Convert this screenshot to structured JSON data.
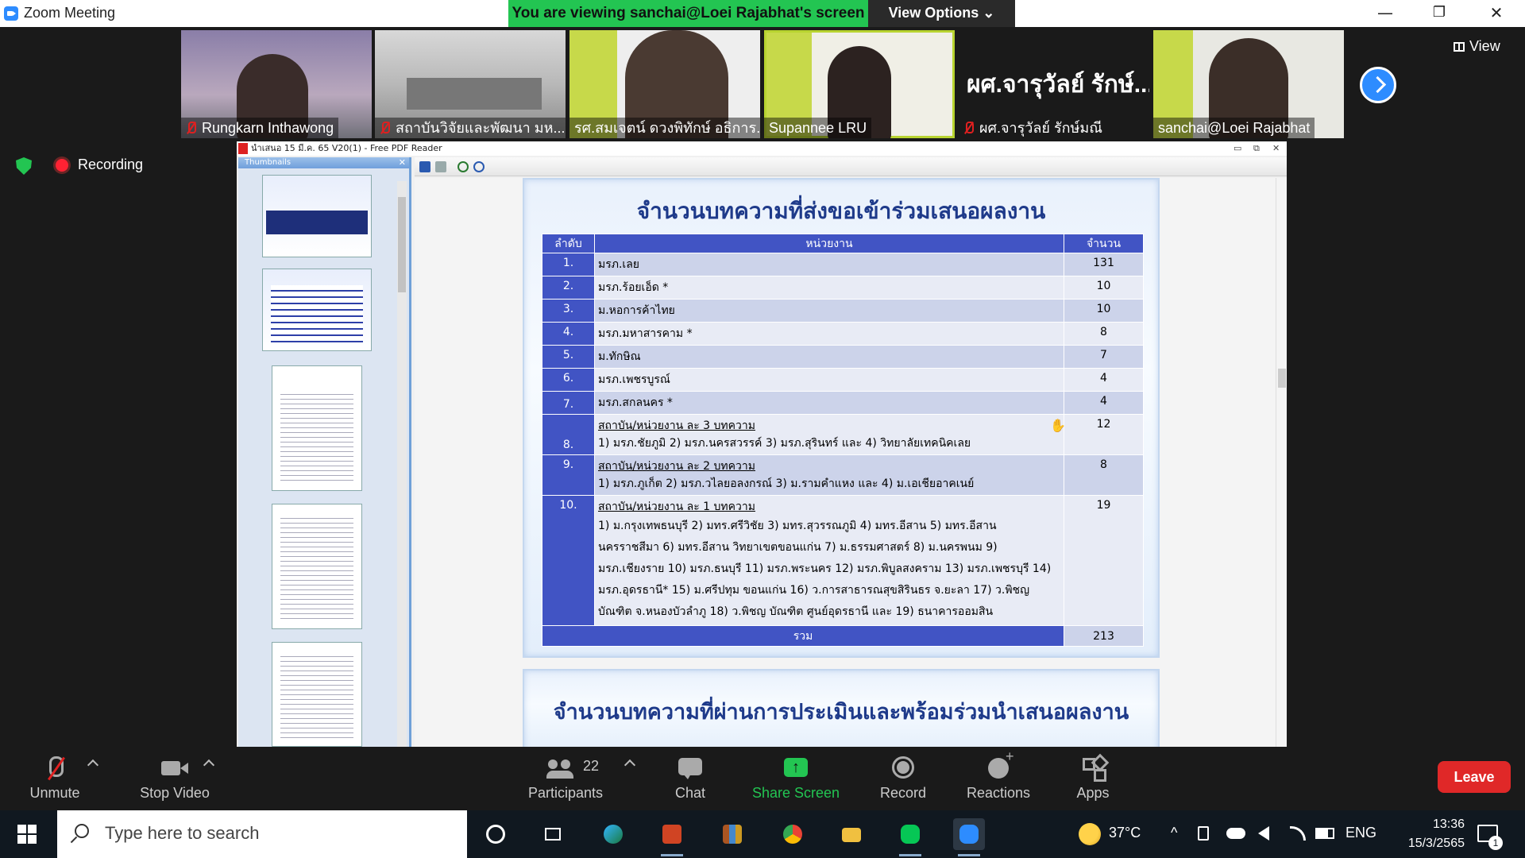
{
  "window": {
    "title": "Zoom Meeting",
    "viewing_banner": "You are viewing sanchai@Loei Rajabhat's screen",
    "view_options": "View Options",
    "view_options_caret": "⌄",
    "minimize": "—",
    "restore": "❐",
    "close": "✕",
    "view_label": "View"
  },
  "participants_strip": [
    {
      "name": "Rungkarn Inthawong",
      "muted": true
    },
    {
      "name": "สถาบันวิจัยและพัฒนา มห...",
      "muted": true
    },
    {
      "name": "รศ.สมเจตน์ ดวงพิทักษ์ อธิการ...",
      "muted": false
    },
    {
      "name": "Supannee LRU",
      "muted": false,
      "active": true
    },
    {
      "name": "ผศ.จารุวัลย์ รักษ์มณี",
      "big_name": "ผศ.จารุวัลย์ รักษ์...",
      "muted": true
    },
    {
      "name": "sanchai@Loei Rajabhat",
      "muted": false
    }
  ],
  "recording": {
    "label": "Recording"
  },
  "pdf_reader": {
    "window_title": "นำเสนอ 15 มี.ค. 65 V20(1) - Free PDF Reader",
    "win_min": "▭",
    "win_restore": "⧉",
    "win_close": "✕",
    "thumbnails_label": "Thumbnails",
    "thumbnails_close": "✕"
  },
  "slide1": {
    "title": "จำนวนบทความที่ส่งขอเข้าร่วมเสนอผลงาน",
    "headers": {
      "no": "ลำดับ",
      "unit": "หน่วยงาน",
      "count": "จำนวน"
    },
    "rows": [
      {
        "no": "1.",
        "unit": "มรภ.เลย",
        "count": "131"
      },
      {
        "no": "2.",
        "unit": "มรภ.ร้อยเอ็ด *",
        "count": "10"
      },
      {
        "no": "3.",
        "unit": "ม.หอการค้าไทย",
        "count": "10"
      },
      {
        "no": "4.",
        "unit": "มรภ.มหาสารคาม *",
        "count": "8"
      },
      {
        "no": "5.",
        "unit": "ม.ทักษิณ",
        "count": "7"
      },
      {
        "no": "6.",
        "unit": "มรภ.เพชรบูรณ์",
        "count": "4"
      },
      {
        "no": "7.",
        "unit": "มรภ.สกลนคร *",
        "count": "4"
      }
    ],
    "groups": [
      {
        "no": "8.",
        "head": "สถาบัน/หน่วยงาน ละ 3 บทความ",
        "detail": "1) มรภ.ชัยภูมิ  2) มรภ.นครสวรรค์  3) มรภ.สุรินทร์ และ 4) วิทยาลัยเทคนิคเลย",
        "count": "12"
      },
      {
        "no": "9.",
        "head": "สถาบัน/หน่วยงาน ละ 2 บทความ",
        "detail": "1) มรภ.ภูเก็ต  2) มรภ.วไลยอลงกรณ์ 3) ม.รามคำแหง และ 4) ม.เอเชียอาคเนย์",
        "count": "8"
      },
      {
        "no": "10.",
        "head": "สถาบัน/หน่วยงาน ละ 1 บทความ",
        "detail": "1) ม.กรุงเทพธนบุรี 2) มทร.ศรีวิชัย 3) มทร.สุวรรณภูมิ 4) มทร.อีสาน 5) มทร.อีสาน นครราชสีมา 6) มทร.อีสาน วิทยาเขตขอนแก่น 7) ม.ธรรมศาสตร์  8) ม.นครพนม  9) มรภ.เชียงราย  10) มรภ.ธนบุรี 11) มรภ.พระนคร  12) มรภ.พิบูลสงคราม     13) มรภ.เพชรบุรี 14) มรภ.อุดรธานี* 15) ม.ศรีปทุม ขอนแก่น 16) ว.การสาธารณสุขสิรินธร จ.ยะลา 17) ว.พิชญบัณฑิต จ.หนองบัวลำภู 18) ว.พิชญ บัณฑิต ศูนย์อุดรธานี  และ 19) ธนาคารออมสิน",
        "count": "19"
      }
    ],
    "total_label": "รวม",
    "total_count": "213"
  },
  "slide2": {
    "title": "จำนวนบทความที่ผ่านการประเมินและพร้อมร่วมนำเสนอผลงาน"
  },
  "controls": {
    "unmute": "Unmute",
    "stop_video": "Stop Video",
    "participants": "Participants",
    "participants_count": "22",
    "chat": "Chat",
    "share_screen": "Share Screen",
    "record": "Record",
    "reactions": "Reactions",
    "apps": "Apps",
    "leave": "Leave"
  },
  "taskbar": {
    "search_placeholder": "Type here to search",
    "temperature": "37°C",
    "language": "ENG",
    "time": "13:36",
    "date": "15/3/2565",
    "notification_count": "1",
    "tray_chevron": "^"
  },
  "colors": {
    "zoom_blue": "#2D8CFF",
    "banner_green": "#23c552",
    "leave_red": "#e02828",
    "table_header": "#4154c4",
    "slide_title": "#1e3a8a"
  }
}
